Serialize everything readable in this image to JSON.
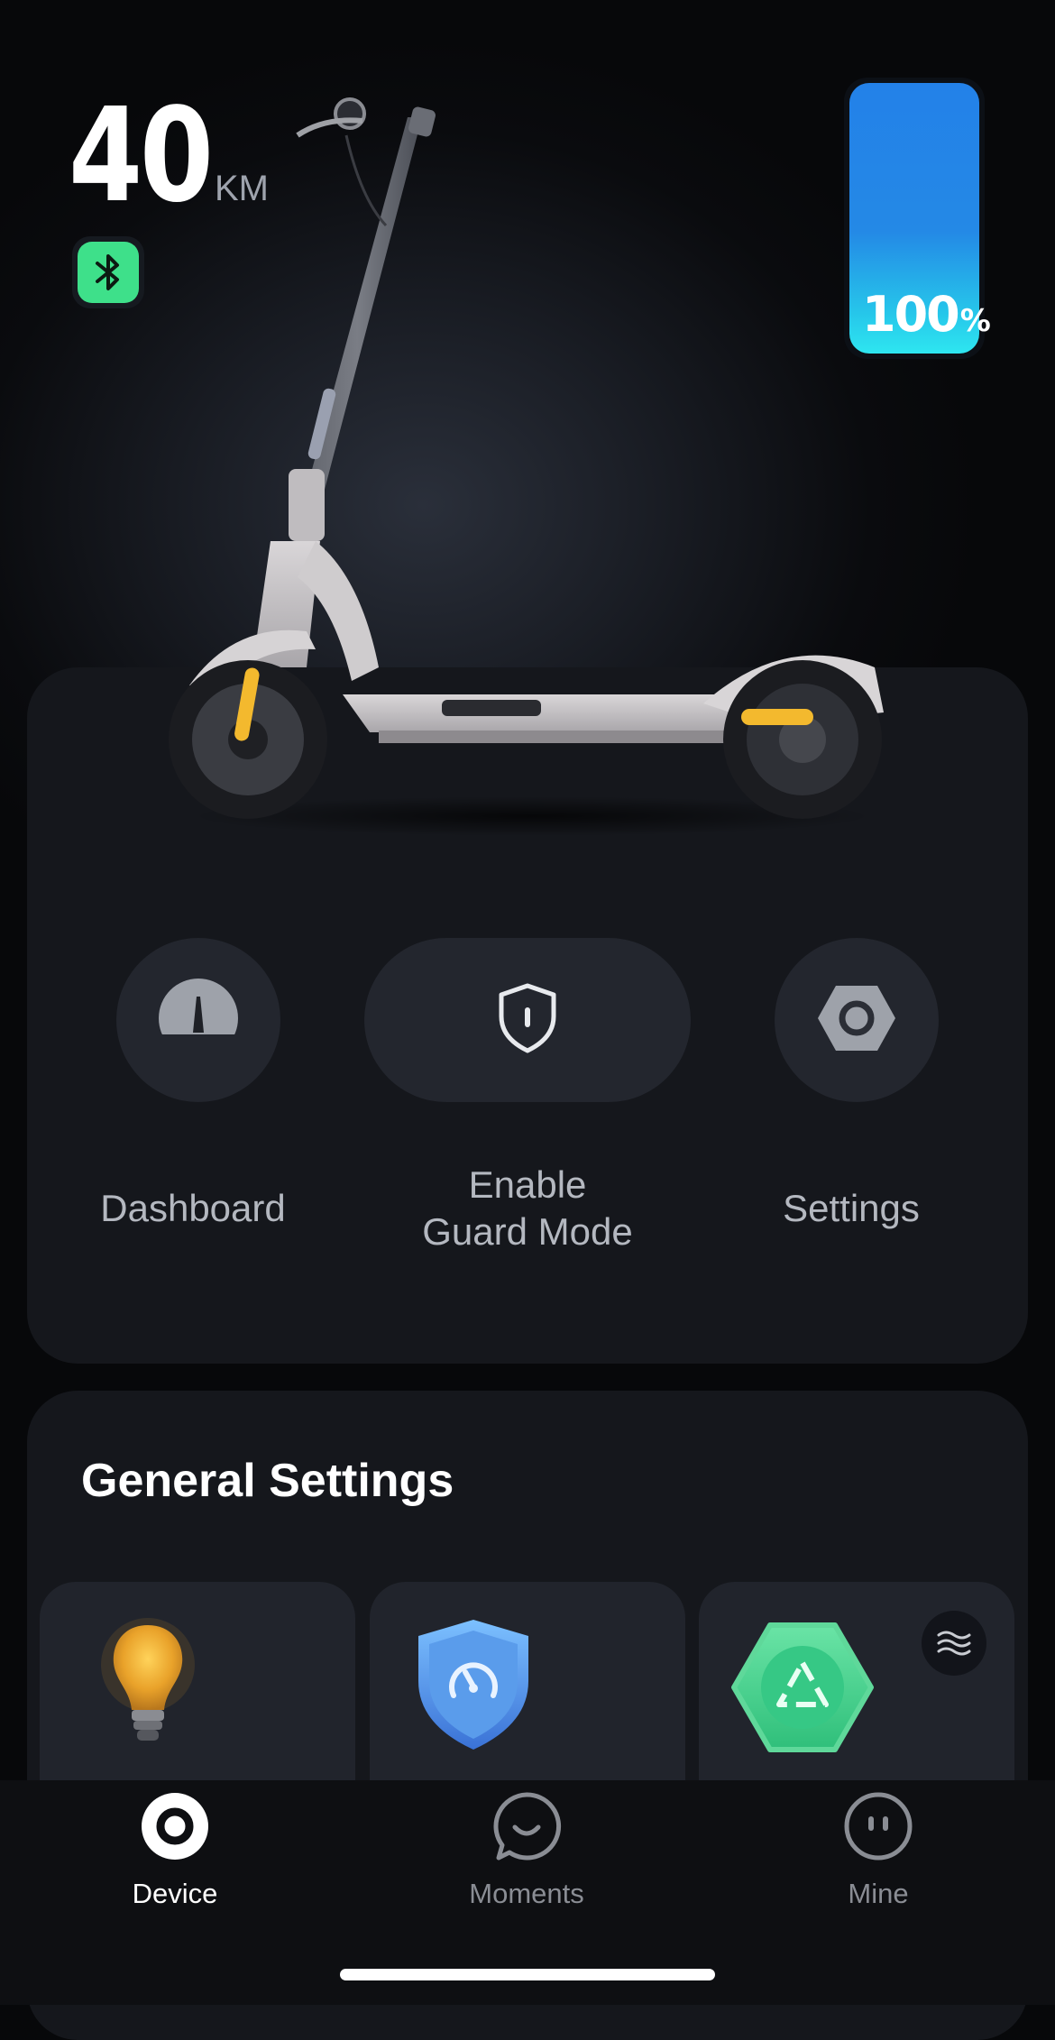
{
  "status": {
    "range_value": "40",
    "range_unit": "KM",
    "battery_value": "100",
    "battery_unit": "%",
    "battery_level": 1.0,
    "bluetooth_icon": "bluetooth-icon",
    "bluetooth_color": "#3ee08a",
    "battery_color": "#2381e8"
  },
  "actions": {
    "dashboard_label": "Dashboard",
    "guard_label_line1": "Enable",
    "guard_label_line2": "Guard Mode",
    "settings_label": "Settings",
    "dashboard_icon": "speedometer-icon",
    "guard_icon": "shield-icon",
    "settings_icon": "hex-nut-icon"
  },
  "general": {
    "title": "General Settings",
    "tiles": [
      {
        "icon": "lightbulb-icon"
      },
      {
        "icon": "speed-shield-icon"
      },
      {
        "icon": "recycle-badge-icon",
        "badge_icon": "wave-icon"
      }
    ]
  },
  "nav": {
    "device_label": "Device",
    "moments_label": "Moments",
    "mine_label": "Mine",
    "active": "Device"
  }
}
